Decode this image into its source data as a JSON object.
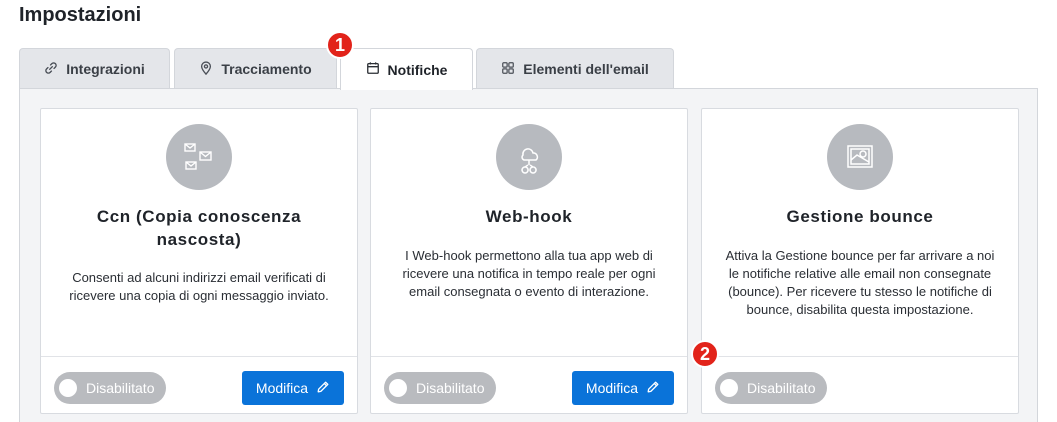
{
  "page": {
    "title": "Impostazioni"
  },
  "tabs": [
    {
      "label": "Integrazioni",
      "icon": "link-icon",
      "active": false
    },
    {
      "label": "Tracciamento",
      "icon": "location-pin-icon",
      "active": false
    },
    {
      "label": "Notifiche",
      "icon": "calendar-icon",
      "active": true
    },
    {
      "label": "Elementi dell'email",
      "icon": "grid-icon",
      "active": false
    }
  ],
  "cards": [
    {
      "icon": "envelopes-icon",
      "title": "Ccn (Copia conoscenza nascosta)",
      "description": "Consenti ad alcuni indirizzi email verificati di ricevere una copia di ogni messaggio inviato.",
      "toggle_label": "Disabilitato",
      "edit_label": "Modifica"
    },
    {
      "icon": "webhook-icon",
      "title": "Web-hook",
      "description": "I Web-hook permettono alla tua app web di ricevere una notifica in tempo reale per ogni email consegnata o evento di interazione.",
      "toggle_label": "Disabilitato",
      "edit_label": "Modifica"
    },
    {
      "icon": "bounce-image-icon",
      "title": "Gestione bounce",
      "description": "Attiva la Gestione bounce per far arrivare a noi le notifiche relative alle email non consegnate (bounce). Per ricevere tu stesso le notifiche di bounce, disabilita questa impostazione.",
      "toggle_label": "Disabilitato"
    }
  ],
  "markers": [
    "1",
    "2"
  ],
  "colors": {
    "primary": "#0a73d9",
    "marker": "#e2231a",
    "toggle_off": "#b9bbbf",
    "icon_bg": "#b7babf"
  }
}
